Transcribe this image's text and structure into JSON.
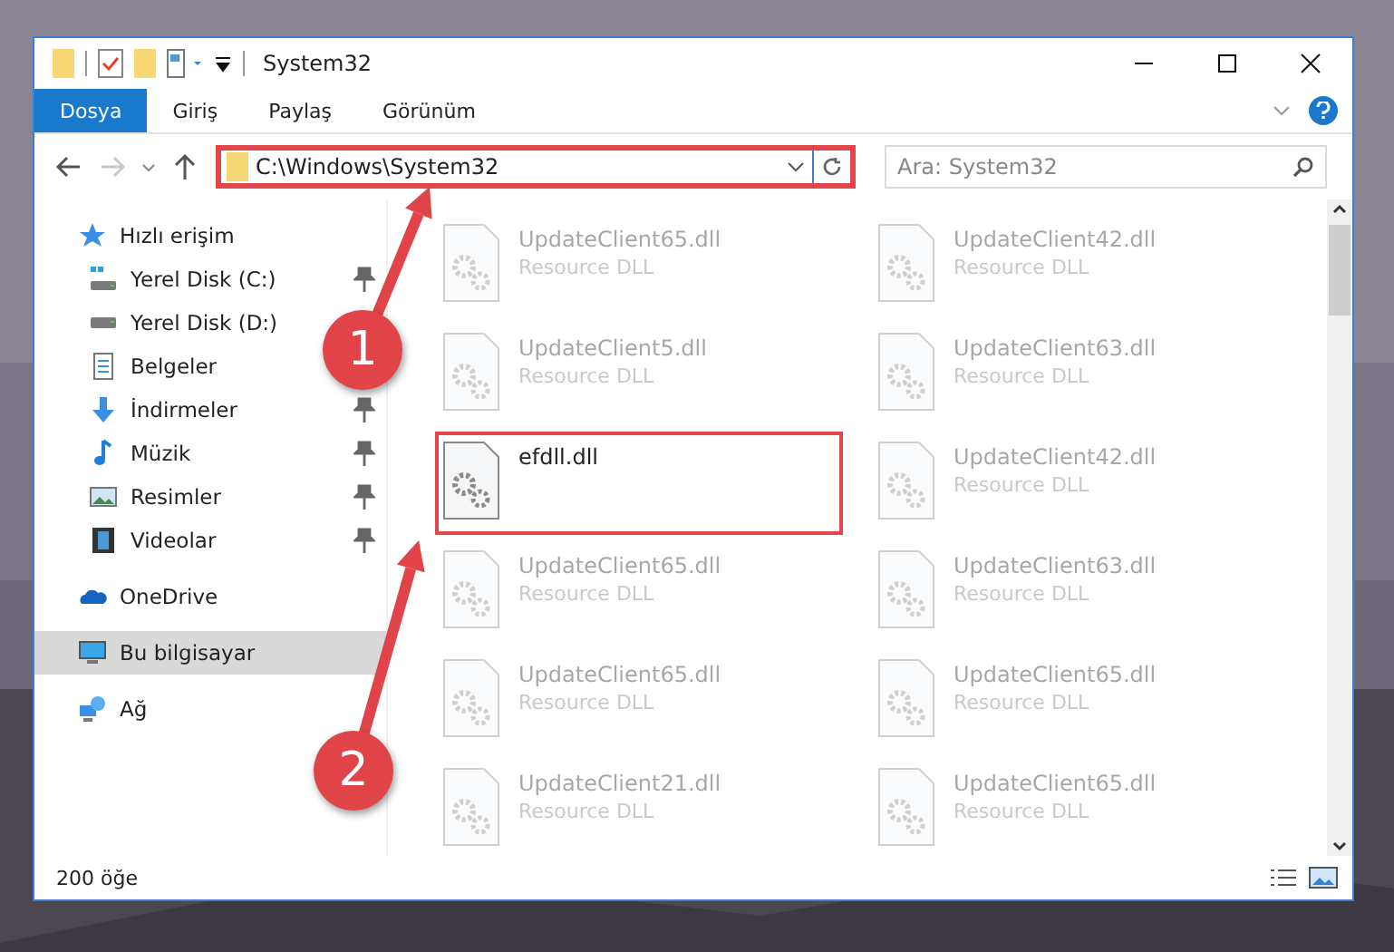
{
  "window": {
    "title": "System32"
  },
  "ribbon": {
    "tabs": [
      {
        "label": "Dosya",
        "selected": true
      },
      {
        "label": "Giriş",
        "selected": false
      },
      {
        "label": "Paylaş",
        "selected": false
      },
      {
        "label": "Görünüm",
        "selected": false
      }
    ]
  },
  "address_bar": {
    "path": "C:\\Windows\\System32",
    "highlighted": true
  },
  "search": {
    "placeholder": "Ara: System32"
  },
  "navigation": [
    {
      "label": "Hızlı erişim",
      "kind": "star",
      "selected": false,
      "children": [
        {
          "label": "Yerel Disk (C:)",
          "kind": "windrive",
          "pinned": true,
          "selected": false
        },
        {
          "label": "Yerel Disk (D:)",
          "kind": "drive",
          "pinned": false,
          "selected": false
        },
        {
          "label": "Belgeler",
          "kind": "document",
          "pinned": false,
          "selected": false
        },
        {
          "label": "İndirmeler",
          "kind": "download",
          "pinned": true,
          "selected": false
        },
        {
          "label": "Müzik",
          "kind": "music",
          "pinned": true,
          "selected": false
        },
        {
          "label": "Resimler",
          "kind": "pictures",
          "pinned": true,
          "selected": false
        },
        {
          "label": "Videolar",
          "kind": "video",
          "pinned": true,
          "selected": false
        }
      ]
    },
    {
      "label": "OneDrive",
      "kind": "cloud",
      "selected": false
    },
    {
      "label": "Bu bilgisayar",
      "kind": "computer",
      "selected": true
    },
    {
      "label": "Ağ",
      "kind": "network",
      "selected": false
    }
  ],
  "files": [
    {
      "name": "UpdateClient65.dll",
      "type": "Resource DLL",
      "blurred": true,
      "highlighted": false
    },
    {
      "name": "UpdateClient42.dll",
      "type": "Resource DLL",
      "blurred": true,
      "highlighted": false
    },
    {
      "name": "UpdateClient5.dll",
      "type": "Resource DLL",
      "blurred": true,
      "highlighted": false
    },
    {
      "name": "UpdateClient63.dll",
      "type": "Resource DLL",
      "blurred": true,
      "highlighted": false
    },
    {
      "name": "efdll.dll",
      "blurred": false,
      "highlighted": true
    },
    {
      "name": "UpdateClient42.dll",
      "type": "Resource DLL",
      "blurred": true,
      "highlighted": false
    },
    {
      "name": "UpdateClient65.dll",
      "type": "Resource DLL",
      "blurred": true,
      "highlighted": false
    },
    {
      "name": "UpdateClient63.dll",
      "type": "Resource DLL",
      "blurred": true,
      "highlighted": false
    },
    {
      "name": "UpdateClient65.dll",
      "type": "Resource DLL",
      "blurred": true,
      "highlighted": false
    },
    {
      "name": "UpdateClient65.dll",
      "type": "Resource DLL",
      "blurred": true,
      "highlighted": false
    },
    {
      "name": "UpdateClient21.dll",
      "type": "Resource DLL",
      "blurred": true,
      "highlighted": false
    },
    {
      "name": "UpdateClient65.dll",
      "type": "Resource DLL",
      "blurred": true,
      "highlighted": false
    }
  ],
  "status_bar": {
    "item_count": "200 öğe"
  },
  "annotations": [
    {
      "number": "1"
    },
    {
      "number": "2"
    }
  ]
}
